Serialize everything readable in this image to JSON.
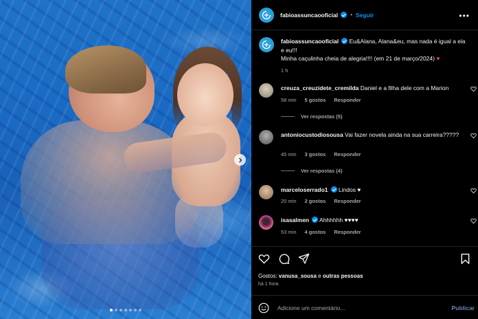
{
  "post": {
    "author": "fabioassuncaooficial",
    "follow_label": "Seguir",
    "separator": "•",
    "more_label": "•••",
    "caption_line1": "Eu&Alana, Alana&eu, mas nada é igual a ela e eu!!!",
    "caption_line2": "Minha caçulinha cheia de alegria!!!! (em 21 de março/2024)",
    "caption_heart": "♥",
    "caption_time": "1 h",
    "carousel": {
      "dot_count": 7,
      "active_index": 0
    }
  },
  "comments": [
    {
      "username": "creuza_creuzidete_cremilda",
      "verified": false,
      "text": "Daniel e a filha dele com a Marion",
      "time": "58 min",
      "likes": "5 gostos",
      "reply_label": "Responder",
      "view_replies": "Ver respostas (5)"
    },
    {
      "username": "antoniocustodiosousa",
      "verified": false,
      "text": "Vai fazer novela ainda na sua carreira?????",
      "time": "45 min",
      "likes": "3 gostos",
      "reply_label": "Responder",
      "view_replies": "Ver respostas (4)"
    },
    {
      "username": "marceloserrado1",
      "verified": true,
      "text": "Lindos ♥",
      "time": "20 min",
      "likes": "2 gostos",
      "reply_label": "Responder"
    },
    {
      "username": "isasalmen",
      "verified": true,
      "text": "Ahhhhhh ♥♥♥♥",
      "time": "53 min",
      "likes": "4 gostos",
      "reply_label": "Responder"
    }
  ],
  "footer": {
    "likes_prefix": "Gostos: ",
    "likes_user": "vanusa_sousa",
    "likes_join": " e ",
    "likes_others": "outras pessoas",
    "posted_time": "há 1 hora",
    "comment_placeholder": "Adicione um comentário...",
    "publish_label": "Publicar"
  },
  "colors": {
    "accent": "#0095f6",
    "heart": "#ed4956",
    "background": "#000000",
    "muted_text": "#a8a8a8"
  }
}
